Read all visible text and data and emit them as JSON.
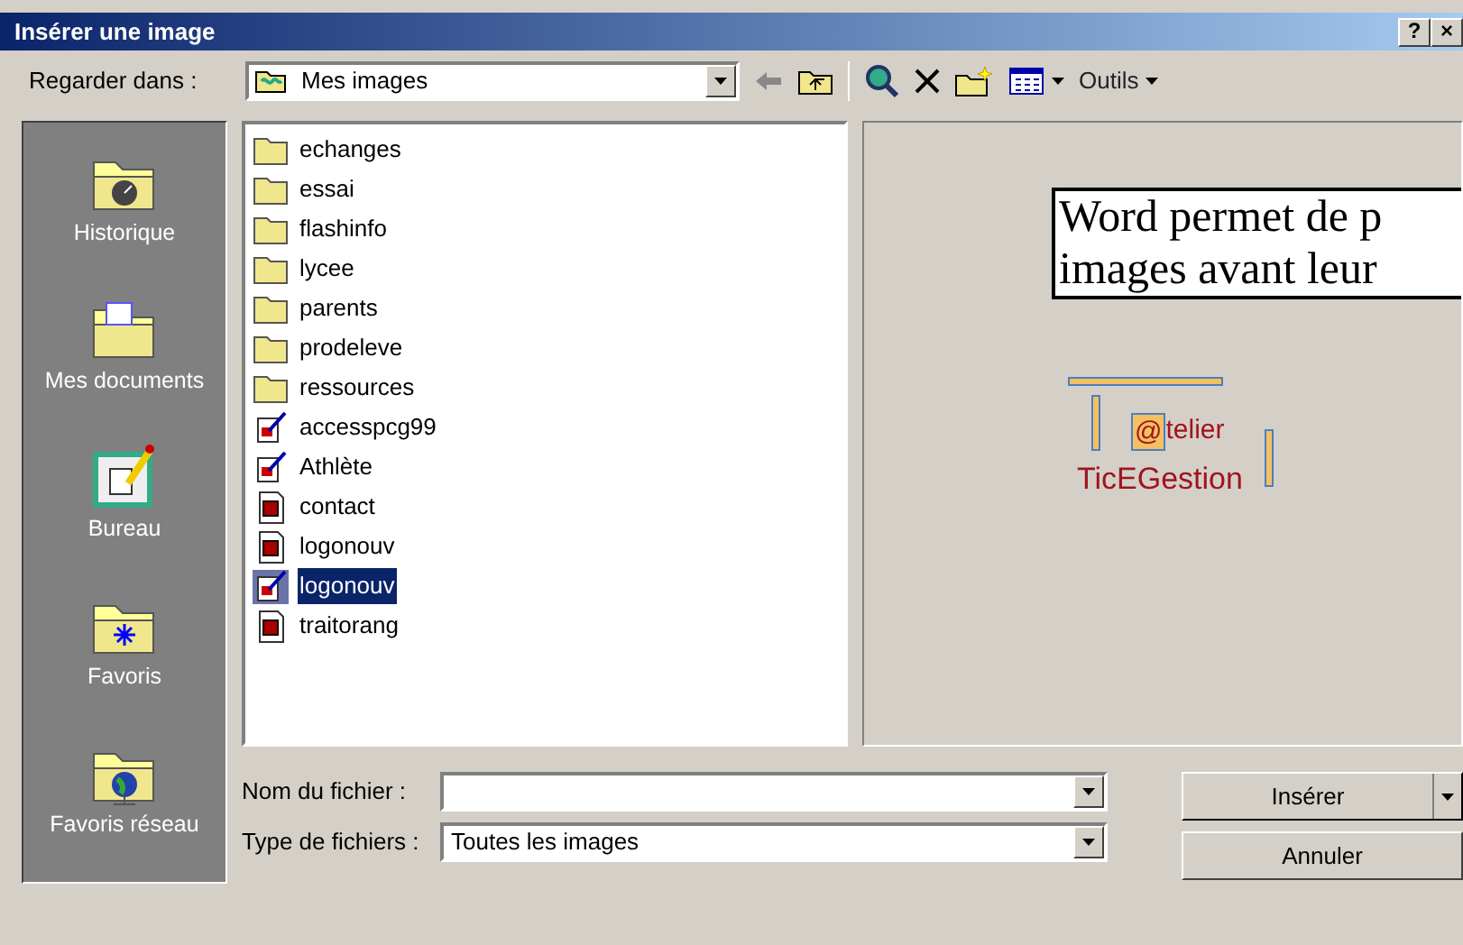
{
  "window": {
    "title": "Insérer une image",
    "buttons": [
      "?",
      "×"
    ]
  },
  "toolbar": {
    "look_in_label": "Regarder dans :",
    "look_in_value": "Mes images",
    "tools_label": "Outils"
  },
  "places": [
    {
      "label": "Historique",
      "kind": "history"
    },
    {
      "label": "Mes documents",
      "kind": "documents"
    },
    {
      "label": "Bureau",
      "kind": "desktop"
    },
    {
      "label": "Favoris",
      "kind": "favorites"
    },
    {
      "label": "Favoris réseau",
      "kind": "network"
    }
  ],
  "files": [
    {
      "name": "echanges",
      "kind": "folder",
      "selected": false
    },
    {
      "name": "essai",
      "kind": "folder",
      "selected": false
    },
    {
      "name": "flashinfo",
      "kind": "folder",
      "selected": false
    },
    {
      "name": "lycee",
      "kind": "folder",
      "selected": false
    },
    {
      "name": "parents",
      "kind": "folder",
      "selected": false
    },
    {
      "name": "prodeleve",
      "kind": "folder",
      "selected": false
    },
    {
      "name": "ressources",
      "kind": "folder",
      "selected": false
    },
    {
      "name": "accesspcg99",
      "kind": "picture",
      "selected": false
    },
    {
      "name": "Athlète",
      "kind": "picture",
      "selected": false
    },
    {
      "name": "contact",
      "kind": "bitmap",
      "selected": false
    },
    {
      "name": "logonouv",
      "kind": "bitmap",
      "selected": false
    },
    {
      "name": "logonouv",
      "kind": "picture",
      "selected": true
    },
    {
      "name": "traitorang",
      "kind": "bitmap",
      "selected": false
    }
  ],
  "preview": {
    "text_lines": [
      "Word permet de p",
      "images avant leur"
    ],
    "logo_at": "@",
    "logo_word": "telier",
    "logo_brand": "TicEGestion"
  },
  "filename": {
    "label": "Nom du fichier :"
  },
  "filetype": {
    "label": "Type de fichiers :",
    "value": "Toutes les images"
  },
  "buttons": [
    "Insérer",
    "Annuler"
  ]
}
